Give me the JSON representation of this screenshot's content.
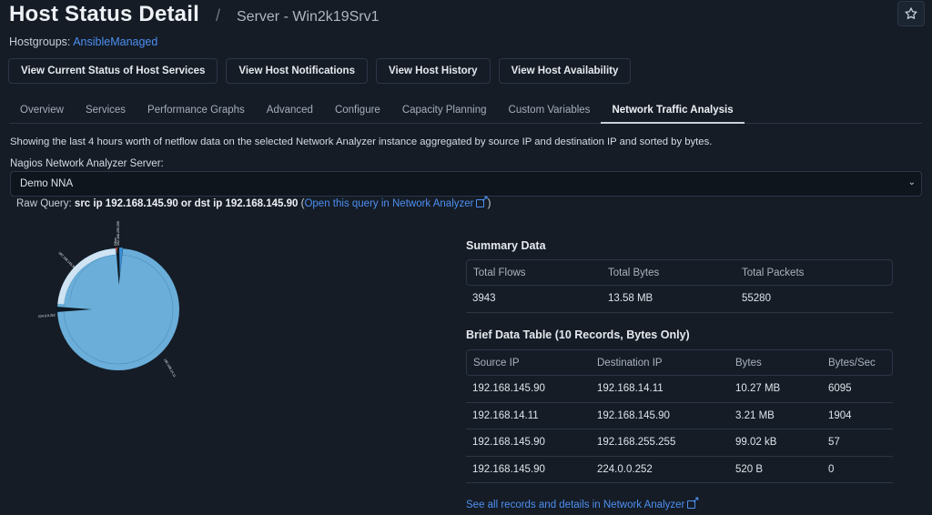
{
  "header": {
    "title": "Host Status Detail",
    "separator": "/",
    "subtitle": "Server - Win2k19Srv1",
    "favorite_icon": "star-outline-icon",
    "hostgroups_label": "Hostgroups:",
    "hostgroup_link": "AnsibleManaged"
  },
  "actions": [
    {
      "label": "View Current Status of Host Services"
    },
    {
      "label": "View Host Notifications"
    },
    {
      "label": "View Host History"
    },
    {
      "label": "View Host Availability"
    }
  ],
  "tabs": [
    {
      "label": "Overview",
      "active": false
    },
    {
      "label": "Services",
      "active": false
    },
    {
      "label": "Performance Graphs",
      "active": false
    },
    {
      "label": "Advanced",
      "active": false
    },
    {
      "label": "Configure",
      "active": false
    },
    {
      "label": "Capacity Planning",
      "active": false
    },
    {
      "label": "Custom Variables",
      "active": false
    },
    {
      "label": "Network Traffic Analysis",
      "active": true
    }
  ],
  "content": {
    "description": "Showing the last 4 hours worth of netflow data on the selected Network Analyzer instance aggregated by source IP and destination IP and sorted by bytes.",
    "server_label": "Nagios Network Analyzer Server:",
    "server_selected": "Demo NNA",
    "raw_query_label": "Raw Query:",
    "raw_query": "src ip 192.168.145.90 or dst ip 192.168.145.90",
    "raw_query_link": "Open this query in Network Analyzer",
    "external_link_icon": "external-link-icon"
  },
  "summary": {
    "heading": "Summary Data",
    "columns": [
      "Total Flows",
      "Total Bytes",
      "Total Packets"
    ],
    "values": [
      "3943",
      "13.58 MB",
      "55280"
    ]
  },
  "brief": {
    "heading": "Brief Data Table (10 Records, Bytes Only)",
    "columns": [
      "Source IP",
      "Destination IP",
      "Bytes",
      "Bytes/Sec"
    ],
    "rows": [
      [
        "192.168.145.90",
        "192.168.14.11",
        "10.27 MB",
        "6095"
      ],
      [
        "192.168.14.11",
        "192.168.145.90",
        "3.21 MB",
        "1904"
      ],
      [
        "192.168.145.90",
        "192.168.255.255",
        "99.02 kB",
        "57"
      ],
      [
        "192.168.145.90",
        "224.0.0.252",
        "520 B",
        "0"
      ]
    ],
    "see_all_link": "See all records and details in Network Analyzer"
  },
  "chart_data": {
    "type": "pie",
    "title": "",
    "description": "Sunburst of bytes by source IP (inner) and destination IP (outer)",
    "inner": [
      {
        "label": "192.168.145.90",
        "value": 10.37
      },
      {
        "label": "192.168.14.11",
        "value": 3.21
      }
    ],
    "outer": [
      {
        "label": "192.168.14.11",
        "value": 10.27,
        "parent": "192.168.145.90"
      },
      {
        "label": "192.168.255.255",
        "value": 0.099,
        "parent": "192.168.145.90"
      },
      {
        "label": "224.0.0.252",
        "value": 0.0005,
        "parent": "192.168.145.90"
      },
      {
        "label": "192.168.145.90",
        "value": 3.21,
        "parent": "192.168.14.11"
      }
    ],
    "unit": "MB",
    "colors": {
      "main": "#6aaed9",
      "light": "#cfe3f3",
      "dark": "#0e1a26",
      "accent": "#3a8fd6",
      "red": "#b2472f"
    }
  }
}
